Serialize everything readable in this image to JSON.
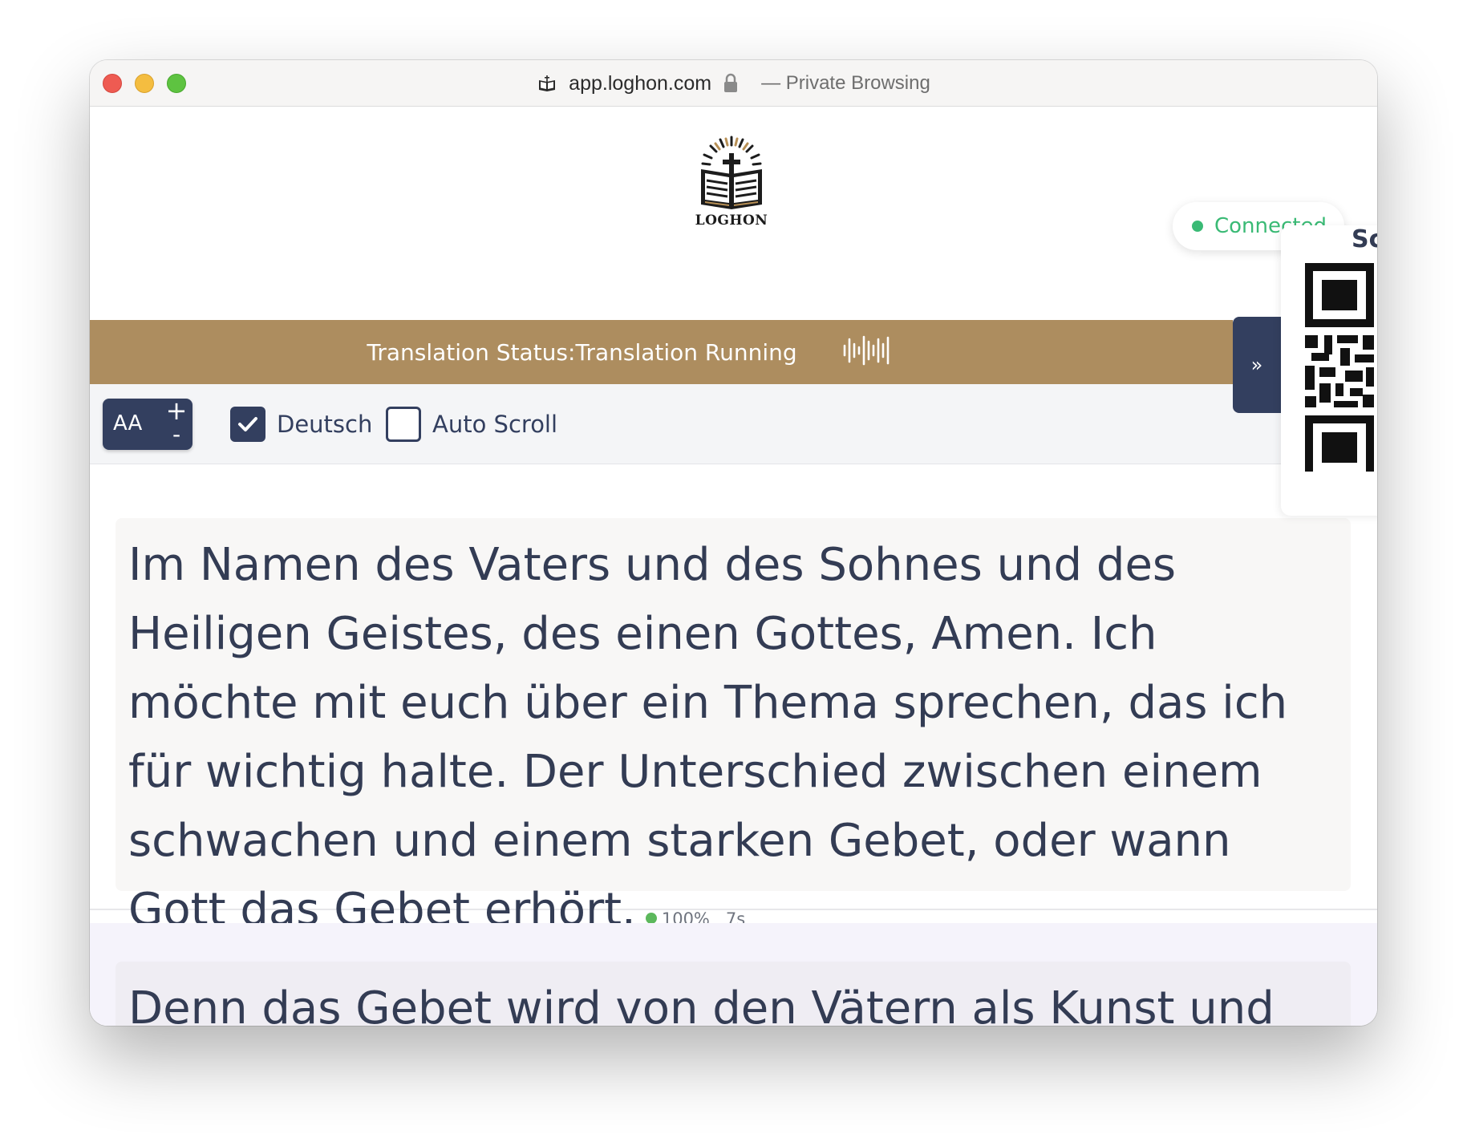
{
  "browser": {
    "url": "app.loghon.com",
    "mode": "— Private Browsing"
  },
  "logo": {
    "text": "LOGHON"
  },
  "status": {
    "label": "Translation Status:",
    "value": "Translation Running"
  },
  "connection": {
    "text": "Connected",
    "color": "#3aba75"
  },
  "side_toggle": {
    "label": "»"
  },
  "qr_panel": {
    "title": "Sc"
  },
  "toolbar": {
    "font_label": "AA",
    "font_plus": "+",
    "font_minus": "-",
    "language": {
      "label": "Deutsch",
      "checked": true
    },
    "auto_scroll": {
      "label": "Auto Scroll",
      "checked": false
    }
  },
  "segments": [
    {
      "text": "Im Namen des Vaters und des Sohnes und des Heiligen Geistes, des einen Gottes, Amen. Ich möchte mit euch über ein Thema sprechen, das ich für wichtig halte. Der Unterschied zwischen einem schwachen und einem starken Gebet, oder wann Gott das Gebet erhört.",
      "confidence": "100%",
      "time": "7s"
    },
    {
      "text": "Denn das Gebet wird von den Vätern als Kunst und Erfahrung betrachtet, die man mit der Zeit erwirbt. Aber es"
    }
  ],
  "colors": {
    "brand_navy": "#333f5f",
    "status_bar": "#ad8d5f",
    "success": "#3aba75"
  },
  "icons": [
    "bible-logo-icon",
    "lock-icon",
    "audio-wave-icon",
    "check-icon",
    "double-chevron-right-icon",
    "qr-code-icon"
  ]
}
